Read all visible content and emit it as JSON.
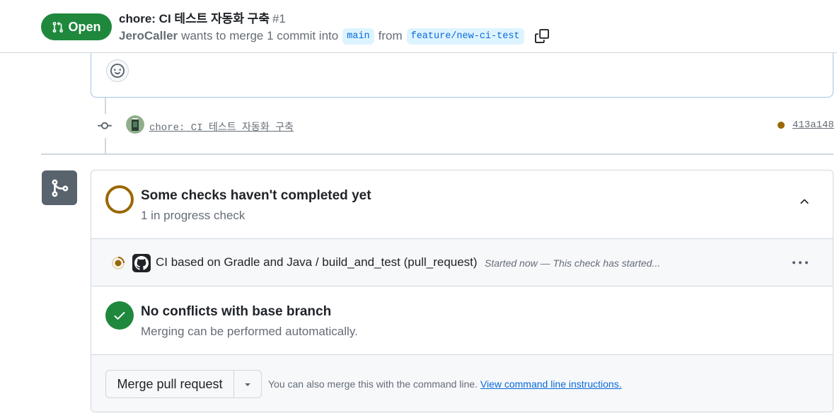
{
  "header": {
    "state_label": "Open",
    "title": "chore: CI 테스트 자동화 구축",
    "number": "#1",
    "author": "JeroCaller",
    "merge_text_1": "wants to merge 1 commit into",
    "base_branch": "main",
    "merge_text_2": "from",
    "head_branch": "feature/new-ci-test",
    "icons": {
      "state": "git-pull-request-icon",
      "copy": "copy-icon"
    },
    "colors": {
      "open": "#1f883d",
      "branch_bg": "#ddf4ff",
      "branch_fg": "#0969da"
    }
  },
  "comment": {
    "icons": {
      "reaction": "smiley-icon"
    }
  },
  "commit": {
    "message": "chore: CI 테스트 자동화 구축",
    "sha": "413a148",
    "status_color": "#9a6700",
    "icons": {
      "commit": "git-commit-icon",
      "avatar": "user-avatar"
    }
  },
  "merge_box": {
    "icons": {
      "merge": "git-merge-icon"
    },
    "checks": {
      "title": "Some checks haven't completed yet",
      "subtitle": "1 in progress check",
      "items": [
        {
          "name": "CI based on Gradle and Java / build_and_test (pull_request)",
          "status": "Started now — This check has started...",
          "icons": {
            "status": "in-progress-icon",
            "app": "github-actions-icon",
            "more": "kebab-horizontal-icon"
          }
        }
      ]
    },
    "conflicts": {
      "title": "No conflicts with base branch",
      "subtitle": "Merging can be performed automatically."
    },
    "actions": {
      "merge_label": "Merge pull request",
      "hint": "You can also merge this with the command line.",
      "hint_link": "View command line instructions."
    }
  }
}
